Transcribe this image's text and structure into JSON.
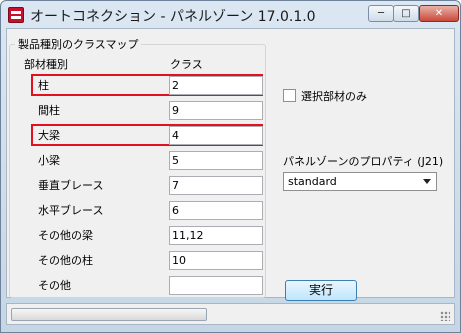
{
  "window": {
    "title": "オートコネクション - パネルゾーン 17.0.1.0",
    "minimize_glyph": "─",
    "maximize_glyph": "□",
    "close_glyph": "✕",
    "app_icon": "app-logo-icon"
  },
  "group": {
    "legend": "製品種別のクラスマップ",
    "col_name": "部材種別",
    "col_class": "クラス"
  },
  "rows": [
    {
      "label": "柱",
      "value": "2",
      "highlighted": true
    },
    {
      "label": "間柱",
      "value": "9",
      "highlighted": false
    },
    {
      "label": "大梁",
      "value": "4",
      "highlighted": true
    },
    {
      "label": "小梁",
      "value": "5",
      "highlighted": false
    },
    {
      "label": "垂直ブレース",
      "value": "7",
      "highlighted": false
    },
    {
      "label": "水平ブレース",
      "value": "6",
      "highlighted": false
    },
    {
      "label": "その他の梁",
      "value": "11,12",
      "highlighted": false
    },
    {
      "label": "その他の柱",
      "value": "10",
      "highlighted": false
    },
    {
      "label": "その他",
      "value": "",
      "highlighted": false
    }
  ],
  "options": {
    "selected_only_label": "選択部材のみ",
    "selected_only_checked": false,
    "property_label": "パネルゾーンのプロパティ (J21)",
    "property_value": "standard"
  },
  "actions": {
    "execute_label": "実行"
  },
  "colors": {
    "highlight": "#e3101f",
    "accent": "#3c7fb1"
  }
}
